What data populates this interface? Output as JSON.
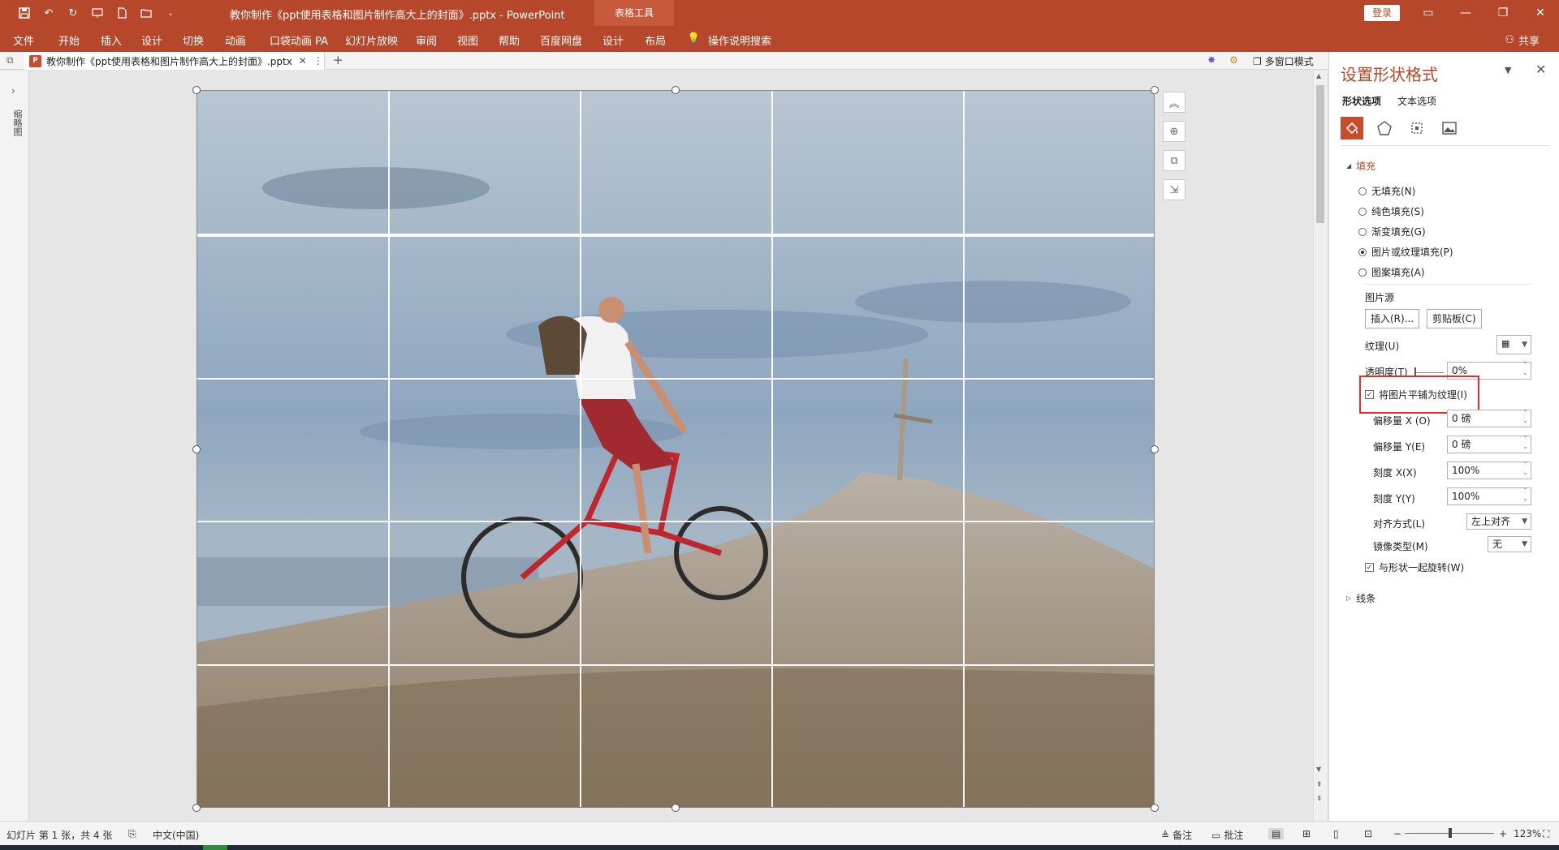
{
  "titlebar": {
    "doc_title": "教你制作《ppt使用表格和图片制作高大上的封面》.pptx  -  PowerPoint",
    "context_tab": "表格工具",
    "login": "登录"
  },
  "ribbon": {
    "tabs": [
      "文件",
      "开始",
      "插入",
      "设计",
      "切换",
      "动画",
      "口袋动画 PA",
      "幻灯片放映",
      "审阅",
      "视图",
      "帮助",
      "百度网盘",
      "设计",
      "布局"
    ],
    "tell_me": "操作说明搜索",
    "share": "共享"
  },
  "doctab": {
    "name": "教你制作《ppt使用表格和图片制作高大上的封面》.pptx",
    "badge": "P",
    "multi_window": "多窗口模式"
  },
  "leftpane": {
    "label": "缩略图"
  },
  "format_pane": {
    "title": "设置形状格式",
    "tab_shape": "形状选项",
    "tab_text": "文本选项",
    "fill_section": "填充",
    "fill_options": [
      {
        "label": "无填充(N)",
        "selected": false
      },
      {
        "label": "纯色填充(S)",
        "selected": false
      },
      {
        "label": "渐变填充(G)",
        "selected": false
      },
      {
        "label": "图片或纹理填充(P)",
        "selected": true
      },
      {
        "label": "图案填充(A)",
        "selected": false
      }
    ],
    "picture_source": "图片源",
    "insert_btn": "插入(R)...",
    "clipboard_btn": "剪贴板(C)",
    "texture_label": "纹理(U)",
    "transparency_label": "透明度(T)",
    "transparency_value": "0%",
    "tile_checkbox": "将图片平铺为纹理(I)",
    "offset_x_label": "偏移量 X (O)",
    "offset_x_value": "0 磅",
    "offset_y_label": "偏移量 Y(E)",
    "offset_y_value": "0 磅",
    "scale_x_label": "刻度 X(X)",
    "scale_x_value": "100%",
    "scale_y_label": "刻度 Y(Y)",
    "scale_y_value": "100%",
    "align_label": "对齐方式(L)",
    "align_value": "左上对齐",
    "mirror_label": "镜像类型(M)",
    "mirror_value": "无",
    "rotate_checkbox": "与形状一起旋转(W)",
    "line_section": "线条"
  },
  "statusbar": {
    "slide_info": "幻灯片 第 1 张，共 4 张",
    "language": "中文(中国)",
    "notes": "备注",
    "comments": "批注",
    "zoom": "123%"
  },
  "colors": {
    "accent": "#b7472a",
    "highlight": "#e0302d"
  }
}
